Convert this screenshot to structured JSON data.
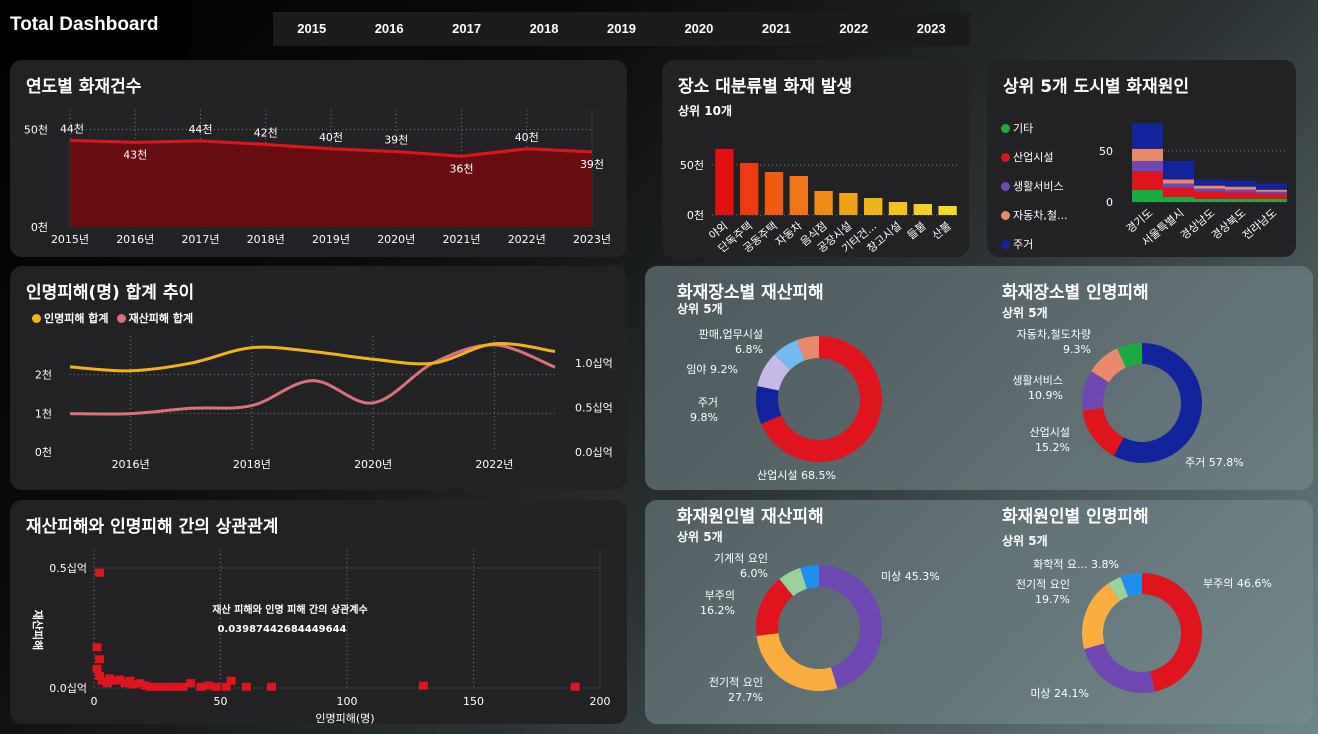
{
  "header": {
    "title": "Total Dashboard",
    "years": [
      "2015",
      "2016",
      "2017",
      "2018",
      "2019",
      "2020",
      "2021",
      "2022",
      "2023"
    ]
  },
  "colors": {
    "red": "#e0141c",
    "darkred": "#6b0d10",
    "yellow": "#f2b21a",
    "pink": "#d9707a",
    "purple": "#7048b4",
    "navy": "#12239e",
    "green": "#1aab40",
    "salmon": "#e8896a",
    "lightblue": "#74b9f0",
    "lavender": "#c5b9e8",
    "orange": "#fbad3e",
    "lightgreen": "#9ad19a",
    "blue": "#1e8ef0"
  },
  "chart_data": [
    {
      "id": "yearly",
      "type": "area",
      "title": "연도별 화재건수",
      "categories": [
        "2015년",
        "2016년",
        "2017년",
        "2018년",
        "2019년",
        "2020년",
        "2021년",
        "2022년",
        "2023년"
      ],
      "values": [
        44435,
        43413,
        44178,
        42338,
        40103,
        38659,
        36267,
        40113,
        38556
      ],
      "data_labels": [
        "44천",
        "43천",
        "44천",
        "42천",
        "40천",
        "39천",
        "36천",
        "40천",
        "39천"
      ],
      "y_ticks": [
        "50천",
        "0천"
      ],
      "ylim": [
        0,
        60000
      ]
    },
    {
      "id": "place",
      "type": "bar",
      "title": "장소 대분류별 화재 발생",
      "subtitle": "상위 10개",
      "categories": [
        "야외",
        "단독주택",
        "공동주택",
        "자동차",
        "음식점",
        "공장시설",
        "기타건...",
        "창고시설",
        "들불",
        "산불"
      ],
      "values": [
        66000,
        52000,
        43000,
        39000,
        24000,
        22000,
        17000,
        13000,
        11000,
        9000
      ],
      "y_ticks": [
        "50천",
        "0천"
      ],
      "ylim": [
        0,
        75000
      ]
    },
    {
      "id": "city",
      "type": "bar",
      "stacked": true,
      "title": "상위 5개 도시별 화재원인",
      "categories": [
        "경기도",
        "서울특별시",
        "경상남도",
        "경상북도",
        "전라남도"
      ],
      "legend": [
        "기타",
        "산업시설",
        "생활서비스",
        "자동차,철...",
        "주거"
      ],
      "series": [
        {
          "name": "기타",
          "values": [
            12,
            5,
            3,
            3,
            3
          ]
        },
        {
          "name": "산업시설",
          "values": [
            18,
            9,
            7,
            6,
            5
          ]
        },
        {
          "name": "생활서비스",
          "values": [
            10,
            4,
            3,
            3,
            2
          ]
        },
        {
          "name": "자동차,철...",
          "values": [
            12,
            4,
            3,
            3,
            2
          ]
        },
        {
          "name": "주거",
          "values": [
            25,
            18,
            6,
            6,
            6
          ]
        }
      ],
      "y_ticks": [
        "50",
        "0"
      ],
      "ylim": [
        0,
        85
      ]
    },
    {
      "id": "trend",
      "type": "line",
      "title": "인명피해(명) 합계 추이",
      "legend": [
        "인명피해 합계",
        "재산피해 합계"
      ],
      "x": [
        2015,
        2016,
        2017,
        2018,
        2019,
        2020,
        2021,
        2022,
        2023
      ],
      "x_ticks": [
        "2016년",
        "2018년",
        "2020년",
        "2022년"
      ],
      "series": [
        {
          "name": "인명피해 합계",
          "axis": "left",
          "values": [
            2200,
            2100,
            2300,
            2700,
            2600,
            2400,
            2300,
            2800,
            2600
          ]
        },
        {
          "name": "재산피해 합계",
          "axis": "right",
          "values": [
            0.43,
            0.43,
            0.49,
            0.52,
            0.8,
            0.55,
            1.0,
            1.2,
            0.95
          ]
        }
      ],
      "y_ticks_left": [
        "2천",
        "1천",
        "0천"
      ],
      "y_ticks_right": [
        "1.0십억",
        "0.5십억",
        "0.0십억"
      ],
      "ylim_left": [
        0,
        3000
      ],
      "ylim_right": [
        0,
        1.3
      ]
    },
    {
      "id": "scatter",
      "type": "scatter",
      "title": "재산피해와 인명피해 간의 상관관계",
      "xlabel": "인명피해(명)",
      "ylabel": "재산피해",
      "annotation_title": "재산 피해와 인명 피해 간의 상관계수",
      "annotation_value": "0.03987442684449644",
      "x_ticks": [
        "0",
        "50",
        "100",
        "150",
        "200"
      ],
      "y_ticks": [
        "0.5십억",
        "0.0십억"
      ],
      "xlim": [
        0,
        200
      ],
      "ylim": [
        0,
        0.5
      ],
      "points": [
        [
          2,
          0.48
        ],
        [
          1,
          0.17
        ],
        [
          2,
          0.12
        ],
        [
          1,
          0.08
        ],
        [
          2,
          0.05
        ],
        [
          3,
          0.03
        ],
        [
          5,
          0.02
        ],
        [
          6,
          0.04
        ],
        [
          8,
          0.03
        ],
        [
          10,
          0.035
        ],
        [
          12,
          0.02
        ],
        [
          14,
          0.03
        ],
        [
          15,
          0.015
        ],
        [
          18,
          0.02
        ],
        [
          20,
          0.01
        ],
        [
          22,
          0.005
        ],
        [
          25,
          0.005
        ],
        [
          28,
          0.005
        ],
        [
          30,
          0.005
        ],
        [
          32,
          0.005
        ],
        [
          35,
          0.005
        ],
        [
          38,
          0.02
        ],
        [
          42,
          0.005
        ],
        [
          45,
          0.01
        ],
        [
          48,
          0.005
        ],
        [
          52,
          0.005
        ],
        [
          54,
          0.03
        ],
        [
          60,
          0.005
        ],
        [
          70,
          0.005
        ],
        [
          130,
          0.01
        ],
        [
          190,
          0.005
        ]
      ]
    },
    {
      "id": "placeProperty",
      "type": "pie",
      "donut": true,
      "title": "화재장소별 재산피해",
      "subtitle": "상위 5개",
      "slices": [
        {
          "label": "산업시설",
          "value": 68.5,
          "text": "산업시설 68.5%"
        },
        {
          "label": "주거",
          "value": 9.8,
          "text": "주거|9.8%"
        },
        {
          "label": "임야",
          "value": 9.2,
          "text": "임야 9.2%"
        },
        {
          "label": "판매,업무시설",
          "value": 6.8,
          "text": "판매,업무시설|6.8%"
        },
        {
          "label": "기타",
          "value": 5.7,
          "text": ""
        }
      ]
    },
    {
      "id": "placeHuman",
      "type": "pie",
      "donut": true,
      "title": "화재장소별 인명피해",
      "subtitle": "상위 5개",
      "slices": [
        {
          "label": "주거",
          "value": 57.8,
          "text": "주거 57.8%"
        },
        {
          "label": "산업시설",
          "value": 15.2,
          "text": "산업시설|15.2%"
        },
        {
          "label": "생활서비스",
          "value": 10.9,
          "text": "생활서비스|10.9%"
        },
        {
          "label": "자동차,철도차량",
          "value": 9.3,
          "text": "자동차,철도차량|9.3%"
        },
        {
          "label": "기타",
          "value": 6.8,
          "text": ""
        }
      ]
    },
    {
      "id": "causeProperty",
      "type": "pie",
      "donut": true,
      "title": "화재원인별 재산피해",
      "subtitle": "상위 5개",
      "slices": [
        {
          "label": "미상",
          "value": 45.3,
          "text": "미상 45.3%"
        },
        {
          "label": "전기적 요인",
          "value": 27.7,
          "text": "전기적 요인|27.7%"
        },
        {
          "label": "부주의",
          "value": 16.2,
          "text": "부주의|16.2%"
        },
        {
          "label": "기계적 요인",
          "value": 6.0,
          "text": "기계적 요인|6.0%"
        },
        {
          "label": "기타",
          "value": 4.8,
          "text": ""
        }
      ]
    },
    {
      "id": "causeHuman",
      "type": "pie",
      "donut": true,
      "title": "화재원인별 인명피해",
      "subtitle": "상위 5개",
      "slices": [
        {
          "label": "부주의",
          "value": 46.6,
          "text": "부주의 46.6%"
        },
        {
          "label": "미상",
          "value": 24.1,
          "text": "미상 24.1%"
        },
        {
          "label": "전기적 요인",
          "value": 19.7,
          "text": "전기적 요인|19.7%"
        },
        {
          "label": "화학적 요...",
          "value": 3.8,
          "text": "화학적 요... 3.8%"
        },
        {
          "label": "기타",
          "value": 5.8,
          "text": ""
        }
      ]
    }
  ]
}
